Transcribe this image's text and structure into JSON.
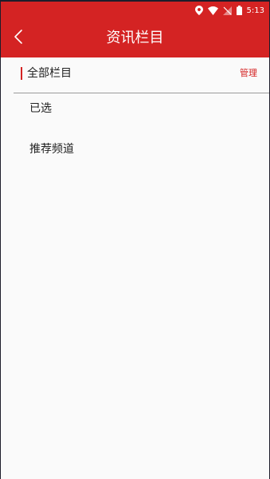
{
  "status_bar": {
    "time": "5:13",
    "icons": [
      "location-icon",
      "wifi-icon",
      "no-signal-icon",
      "battery-icon"
    ]
  },
  "header": {
    "back_icon": "chevron-left-icon",
    "title": "资讯栏目"
  },
  "section": {
    "title": "全部栏目",
    "manage_label": "管理"
  },
  "groups": {
    "selected_label": "已选",
    "recommended_label": "推荐频道"
  },
  "colors": {
    "accent": "#d42323",
    "background": "#fafafa",
    "divider": "#9a9a9a",
    "text": "#222222"
  }
}
